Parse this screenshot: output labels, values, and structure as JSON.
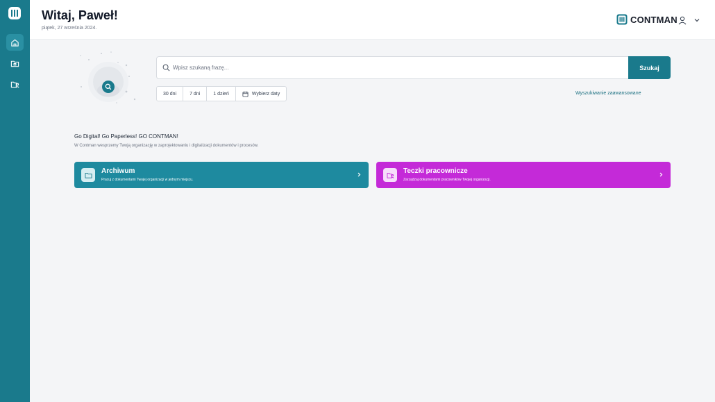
{
  "header": {
    "greeting": "Witaj, Paweł!",
    "date": "piątek, 27 września 2024.",
    "brand": "CONTMAN",
    "user_icon": "user-icon",
    "menu_icon": "chevron-down-icon"
  },
  "sidebar": {
    "logo_icon": "contman-logo-icon",
    "items": [
      {
        "icon": "home-icon",
        "active": true
      },
      {
        "icon": "archive-folder-icon",
        "active": false
      },
      {
        "icon": "personnel-folder-icon",
        "active": false
      }
    ]
  },
  "search": {
    "placeholder": "Wpisz szukaną frazę...",
    "value": "",
    "button_label": "Szukaj",
    "ranges": [
      "30 dni",
      "7 dni",
      "1 dzień"
    ],
    "date_picker_label": "Wybierz daty",
    "advanced_label": "Wyszukiwanie zaawansowane"
  },
  "intro": {
    "tagline": "Go Digital! Go Paperless! GO CONTMAN!",
    "description": "W Contman wesprzemy Twoją organizację w zaprojektowaniu i digitalizacji dokumentów i procesów."
  },
  "cards": [
    {
      "title": "Archiwum",
      "description": "Pracuj z dokumentami Twojej organizacji w jednym miejscu.",
      "icon": "folder-icon"
    },
    {
      "title": "Teczki pracownicze",
      "description": "Zarządzaj dokumentami pracowników Twojej organizacji.",
      "icon": "personnel-folder-icon"
    }
  ],
  "colors": {
    "primary": "#1a7a8c",
    "archive_card": "#1e8a9f",
    "teczki_card": "#c42ad8",
    "background": "#f4f5f7"
  }
}
